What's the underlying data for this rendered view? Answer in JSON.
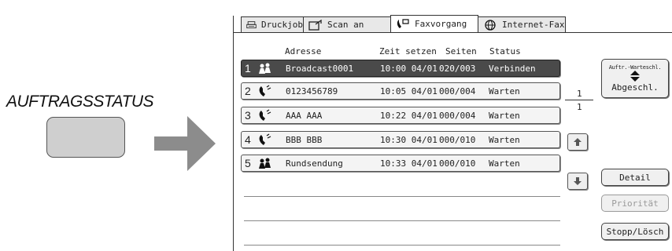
{
  "left": {
    "title": "AUFTRAGSSTATUS"
  },
  "tabs": [
    {
      "label": "Druckjob",
      "icon": "printer-icon"
    },
    {
      "label": "Scan an",
      "icon": "scan-icon"
    },
    {
      "label": "Faxvorgang",
      "icon": "fax-phone-icon",
      "active": true
    },
    {
      "label": "Internet-Fax",
      "icon": "internet-fax-icon"
    }
  ],
  "columns": {
    "address": "Adresse",
    "time": "Zeit setzen",
    "pages": "Seiten",
    "status": "Status"
  },
  "jobs": [
    {
      "num": "1",
      "icon": "broadcast-icon",
      "address": "Broadcast0001",
      "time": "10:00 04/01",
      "pages": "020/003",
      "status": "Verbinden",
      "selected": true
    },
    {
      "num": "2",
      "icon": "phone-icon",
      "address": "0123456789",
      "time": "10:05 04/01",
      "pages": "000/004",
      "status": "Warten"
    },
    {
      "num": "3",
      "icon": "phone-icon",
      "address": "AAA AAA",
      "time": "10:22 04/01",
      "pages": "000/004",
      "status": "Warten"
    },
    {
      "num": "4",
      "icon": "phone-icon",
      "address": "BBB BBB",
      "time": "10:30 04/01",
      "pages": "000/010",
      "status": "Warten"
    },
    {
      "num": "5",
      "icon": "broadcast-icon",
      "address": "Rundsendung",
      "time": "10:33 04/01",
      "pages": "000/010",
      "status": "Warten"
    }
  ],
  "side": {
    "queue_small": "Auftr.-Warteschl.",
    "queue_big": "Abgeschl.",
    "page_current": "1",
    "page_total": "1",
    "detail": "Detail",
    "priority": "Priorität",
    "stop_delete": "Stopp/Lösch"
  }
}
